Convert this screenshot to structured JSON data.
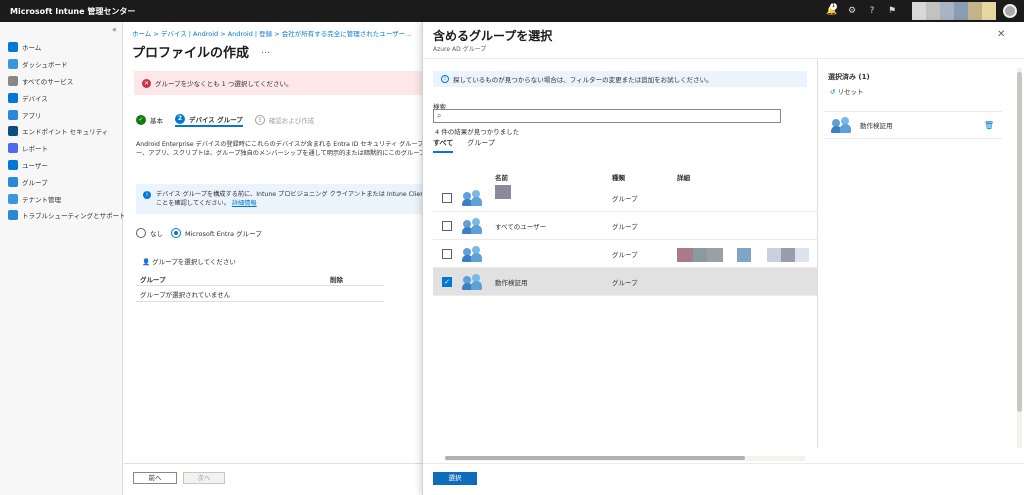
{
  "app": {
    "title": "Microsoft Intune 管理センター",
    "notification_count": "1"
  },
  "sidebar": {
    "items": [
      {
        "label": "ホーム",
        "color": "#0078d4"
      },
      {
        "label": "ダッシュボード",
        "color": "#3a96dd"
      },
      {
        "label": "すべてのサービス",
        "color": "#8a8886"
      },
      {
        "label": "デバイス",
        "color": "#0078d4"
      },
      {
        "label": "アプリ",
        "color": "#2b88d8"
      },
      {
        "label": "エンドポイント セキュリティ",
        "color": "#0f4c81"
      },
      {
        "label": "レポート",
        "color": "#4f6bed"
      },
      {
        "label": "ユーザー",
        "color": "#0078d4"
      },
      {
        "label": "グループ",
        "color": "#2b88d8"
      },
      {
        "label": "テナント管理",
        "color": "#3a96dd"
      },
      {
        "label": "トラブルシューティングとサポート",
        "color": "#2b88d8"
      }
    ]
  },
  "main": {
    "breadcrumb": "ホーム > デバイス | Android > Android | 登録 > 会社が所有する完全に管理されたユーザー…",
    "title": "プロファイルの作成",
    "more": "…",
    "error": "グループを少なくとも 1 つ選択してください。",
    "steps": [
      {
        "num": "✓",
        "label": "基本"
      },
      {
        "num": "2",
        "label": "デバイス グループ"
      },
      {
        "num": "3",
        "label": "確認および作成"
      }
    ],
    "desc_line1": "Android Enterprise デバイスの登録時にこれらのデバイスが含まれる Entra ID セキュリティ グループを",
    "desc_line2": "ー、アプリ、スクリプトは、グループ独自のメンバーシップを通して明示的または暗黙的にこのグループに割り当",
    "info_line1": "デバイス グループを構成する前に、Intune プロビジョニング クライアントまたは Intune ClientConfiden",
    "info_line2": "ことを確認してください。",
    "info_link": "詳細情報",
    "radio_none": "なし",
    "radio_entra": "Microsoft Entra グループ",
    "select_groups": "グループを選択してください",
    "col_group": "グループ",
    "col_delete": "削除",
    "empty": "グループが選択されていません",
    "prev": "前へ",
    "next": "次へ"
  },
  "panel": {
    "title": "含めるグループを選択",
    "subtitle": "Azure AD グループ",
    "info": "探しているものが見つからない場合は、フィルターの変更または追加をお試しください。",
    "search_label": "検索",
    "search_placeholder": "",
    "result_count": "4 件の結果が見つかりました",
    "tabs": [
      "すべて",
      "グループ"
    ],
    "columns": {
      "name": "名前",
      "type": "種類",
      "detail": "詳細"
    },
    "rows": [
      {
        "name": "",
        "type": "グループ",
        "checked": false
      },
      {
        "name": "すべてのユーザー",
        "type": "グループ",
        "checked": false
      },
      {
        "name": "",
        "type": "グループ",
        "checked": false
      },
      {
        "name": "動作検証用",
        "type": "グループ",
        "checked": true
      }
    ],
    "selected_header": "選択済み (1)",
    "reset": "リセット",
    "selected_item": "動作検証用",
    "select_button": "選択"
  }
}
